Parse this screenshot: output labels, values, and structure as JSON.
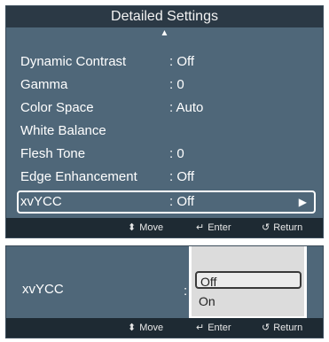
{
  "panel1": {
    "title": "Detailed Settings",
    "scroll_up_icon": "▲",
    "items": [
      {
        "label": "Dynamic Contrast",
        "value": ": Off"
      },
      {
        "label": "Gamma",
        "value": ": 0"
      },
      {
        "label": "Color Space",
        "value": ": Auto"
      },
      {
        "label": "White Balance",
        "value": ""
      },
      {
        "label": "Flesh Tone",
        "value": ": 0"
      },
      {
        "label": "Edge Enhancement",
        "value": ": Off"
      },
      {
        "label": "xvYCC",
        "value": ": Off",
        "selected": true
      }
    ],
    "selected_arrow_icon": "▶"
  },
  "footer": {
    "move_icon": "⬍",
    "move_label": "Move",
    "enter_icon": "↵",
    "enter_label": "Enter",
    "return_icon": "↺",
    "return_label": "Return"
  },
  "panel2": {
    "label": "xvYCC",
    "colon": ":",
    "options": [
      "Off",
      "On"
    ],
    "selected_option": "Off"
  }
}
